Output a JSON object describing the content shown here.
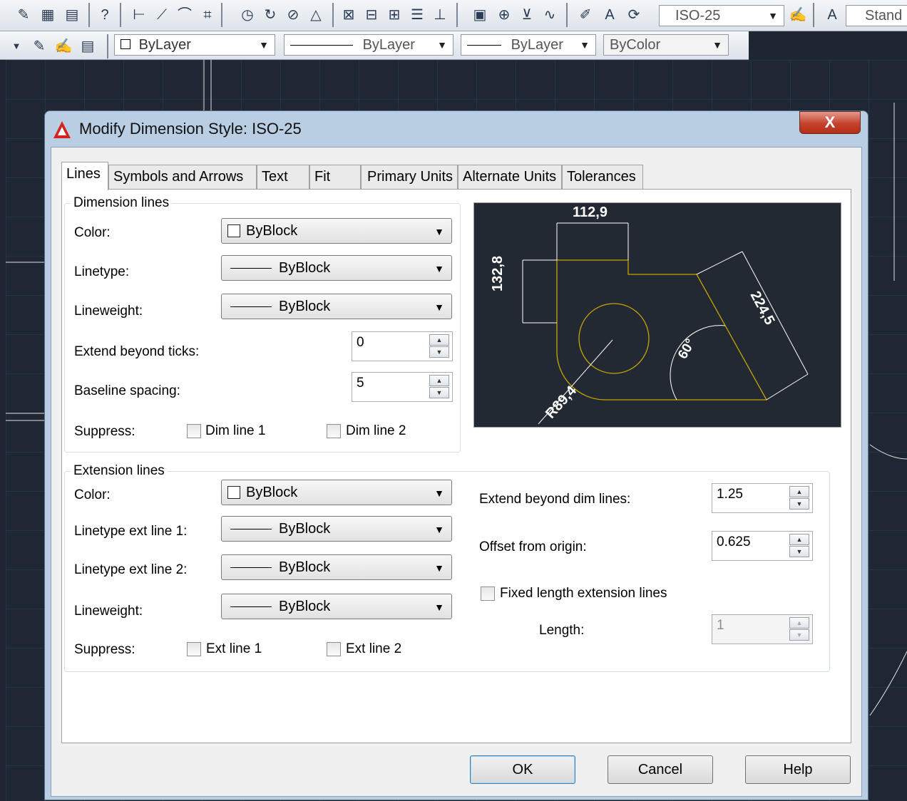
{
  "toolbar1": {
    "dimstyle_combo": "ISO-25",
    "textstyle_combo": "Stand"
  },
  "toolbar2": {
    "layer_color": "ByLayer",
    "linetype": "ByLayer",
    "lineweight": "ByLayer",
    "plotstyle": "ByColor"
  },
  "dialog": {
    "title": "Modify Dimension Style: ISO-25",
    "close_label": "X",
    "tabs": [
      {
        "label": "Lines"
      },
      {
        "label": "Symbols and Arrows"
      },
      {
        "label": "Text"
      },
      {
        "label": "Fit"
      },
      {
        "label": "Primary Units"
      },
      {
        "label": "Alternate Units"
      },
      {
        "label": "Tolerances"
      }
    ],
    "dimension_lines": {
      "title": "Dimension lines",
      "color_label": "Color:",
      "color_value": "ByBlock",
      "linetype_label": "Linetype:",
      "linetype_value": "ByBlock",
      "lineweight_label": "Lineweight:",
      "lineweight_value": "ByBlock",
      "extend_label": "Extend beyond ticks:",
      "extend_value": "0",
      "baseline_label": "Baseline spacing:",
      "baseline_value": "5",
      "suppress_label": "Suppress:",
      "dim1_label": "Dim line 1",
      "dim2_label": "Dim line 2"
    },
    "preview": {
      "dim_top": "112,9",
      "dim_left": "132,8",
      "dim_right": "224,5",
      "dim_angle": "60°",
      "dim_radius": "R89,4"
    },
    "extension_lines": {
      "title": "Extension lines",
      "color_label": "Color:",
      "color_value": "ByBlock",
      "lt1_label": "Linetype ext line 1:",
      "lt1_value": "ByBlock",
      "lt2_label": "Linetype ext line 2:",
      "lt2_value": "ByBlock",
      "lineweight_label": "Lineweight:",
      "lineweight_value": "ByBlock",
      "suppress_label": "Suppress:",
      "ext1_label": "Ext line 1",
      "ext2_label": "Ext line 2",
      "extend_label": "Extend beyond dim lines:",
      "extend_value": "1.25",
      "offset_label": "Offset from origin:",
      "offset_value": "0.625",
      "fixed_label": "Fixed length extension lines",
      "length_label": "Length:",
      "length_value": "1"
    },
    "buttons": {
      "ok": "OK",
      "cancel": "Cancel",
      "help": "Help"
    }
  },
  "colors": {
    "title_bar": "#b9cde3",
    "close_button": "#c4412b",
    "preview_bg": "#222932",
    "preview_geometry": "#c8a400",
    "canvas_bg": "#1f2735"
  }
}
